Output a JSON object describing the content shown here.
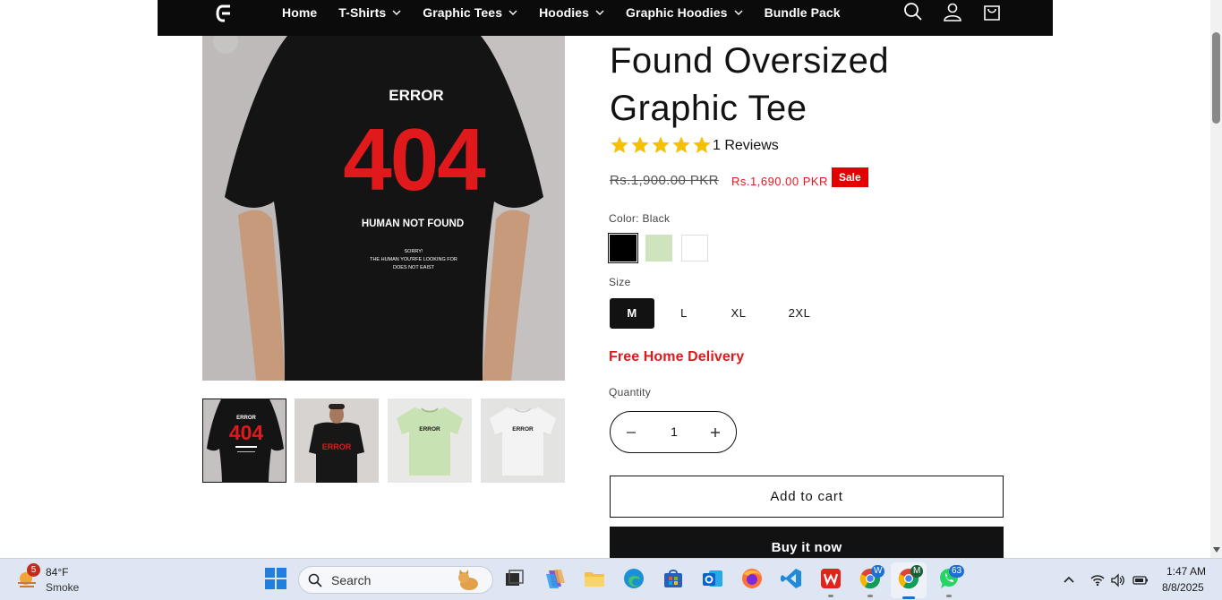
{
  "header": {
    "nav": [
      {
        "label": "Home",
        "dropdown": false
      },
      {
        "label": "T-Shirts",
        "dropdown": true
      },
      {
        "label": "Graphic Tees",
        "dropdown": true
      },
      {
        "label": "Hoodies",
        "dropdown": true
      },
      {
        "label": "Graphic Hoodies",
        "dropdown": true
      },
      {
        "label": "Bundle Pack",
        "dropdown": false
      }
    ],
    "icons": [
      "search-icon",
      "account-icon",
      "cart-icon"
    ]
  },
  "gallery": {
    "main_image": {
      "shirt_color": "#141414",
      "print_top": "ERROR",
      "print_number": "404",
      "print_sub": "HUMAN NOT FOUND",
      "print_small_1": "SORRY!",
      "print_small_2": "THE HUMAN YOU'RFE LOOKING FOR",
      "print_small_3": "DOES NOT EAIST"
    },
    "thumbnails": [
      {
        "variant": "back-black",
        "selected": true
      },
      {
        "variant": "model-front-black",
        "selected": false
      },
      {
        "variant": "front-green",
        "selected": false
      },
      {
        "variant": "front-white",
        "selected": false
      }
    ],
    "thumb_print_top": "ERROR",
    "thumb_print_number": "404"
  },
  "product": {
    "title_line1": "Found Oversized",
    "title_line2": "Graphic Tee",
    "rating": 5,
    "reviews_label": "1 Reviews",
    "price_old": "Rs.1,900.00 PKR",
    "price_new": "Rs.1,690.00 PKR",
    "sale_badge": "Sale",
    "color_label": "Color: Black",
    "colors": [
      {
        "name": "Black",
        "hex": "#000000",
        "selected": true
      },
      {
        "name": "Green",
        "hex": "#cfe3bc",
        "selected": false
      },
      {
        "name": "White",
        "hex": "#ffffff",
        "selected": false
      }
    ],
    "size_label": "Size",
    "sizes": [
      {
        "label": "M",
        "selected": true
      },
      {
        "label": "L",
        "selected": false
      },
      {
        "label": "XL",
        "selected": false
      },
      {
        "label": "2XL",
        "selected": false
      }
    ],
    "delivery": "Free Home Delivery",
    "quantity_label": "Quantity",
    "quantity": "1",
    "add_to_cart": "Add to cart",
    "buy_now": "Buy it now"
  },
  "taskbar": {
    "weather_badge": "5",
    "temperature": "84°F",
    "weather": "Smoke",
    "search_placeholder": "Search",
    "apps": [
      "start-icon",
      "task-view-icon",
      "copilot-icon",
      "file-explorer-icon",
      "edge-icon",
      "store-icon",
      "outlook-icon",
      "firefox-icon",
      "vscode-icon",
      "wps-icon",
      "chrome-w-icon",
      "chrome-m-icon",
      "whatsapp-icon"
    ],
    "chrome_w_badge": "W",
    "chrome_m_badge": "M",
    "whatsapp_badge": "63",
    "time": "1:47 AM",
    "date": "8/8/2025"
  },
  "colors": {
    "accent_red": "#e0191d",
    "header_bg": "#0b0b0b",
    "taskbar_bg": "#dde6f2"
  }
}
